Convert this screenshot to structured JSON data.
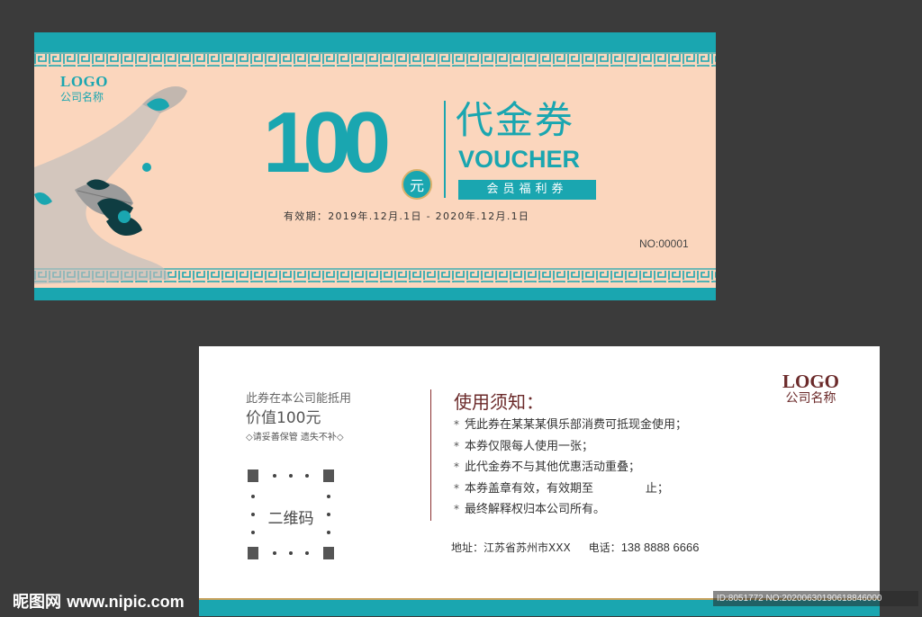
{
  "colors": {
    "teal": "#1aa6b0",
    "peach": "#fbd6bd",
    "gold": "#c9a35d",
    "maroon": "#6b2a2a",
    "background": "#3b3b3b"
  },
  "front": {
    "logo": "LOGO",
    "company": "公司名称",
    "amount": "100",
    "unit": "元",
    "title_cn": "代金券",
    "title_en": "VOUCHER",
    "member_label": "会员福利券",
    "validity": "有效期：2019年.12月.1日 - 2020年.12月.1日",
    "serial": "NO:00001"
  },
  "back": {
    "line1": "此券在本公司能抵用",
    "line2": "价值100元",
    "line3": "◇请妥善保管 遗失不补◇",
    "qr_label": "二维码",
    "notice_title": "使用须知：",
    "rules": [
      "凭此券在某某某俱乐部消费可抵现金使用；",
      "本券仅限每人使用一张；",
      "此代金券不与其他优惠活动重叠；",
      "本券盖章有效，有效期至              止；",
      "最终解释权归本公司所有。"
    ],
    "address": "地址：江苏省苏州市XXX",
    "phone_label": "电话：",
    "phone": "138 8888 6666",
    "logo": "LOGO",
    "company": "公司名称"
  },
  "watermark": {
    "brand": "昵图网",
    "url": "www.nipic.com",
    "id_text": "ID:8051772 NO:20200630190618846000"
  }
}
